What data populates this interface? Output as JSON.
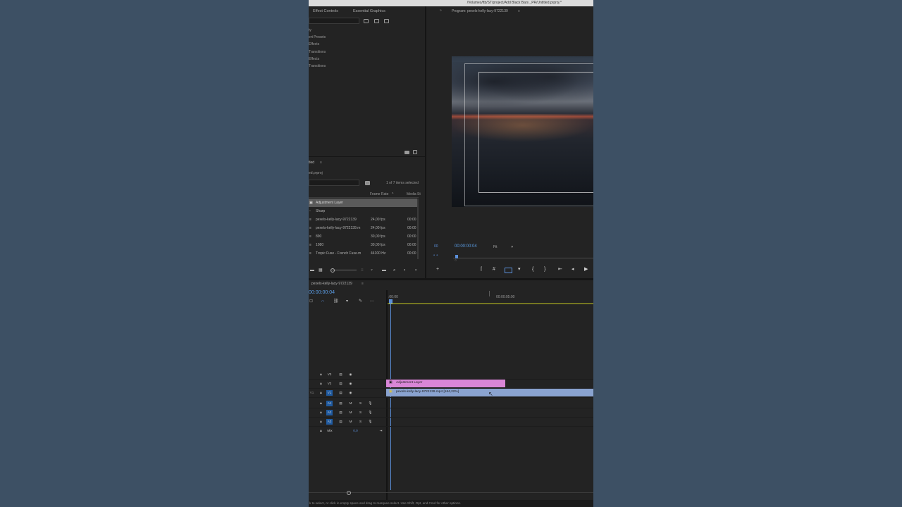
{
  "window": {
    "title_path": "/Volumes/ftb/ST/project/Add Black Bars _PR/Untitled.prproj *"
  },
  "effects_panel": {
    "tabs": [
      "Effect Controls",
      "Essential Graphics"
    ],
    "items": [
      "ty",
      "ert Presets",
      "Effects",
      "Transitions",
      "Effects",
      "Transitions"
    ]
  },
  "project_panel": {
    "title": "tled",
    "path": "ed.prproj",
    "selection_status": "1 of 7 items selected",
    "columns": [
      "Frame Rate",
      "Media St"
    ],
    "rows": [
      {
        "name": "Adjustment Layer",
        "fps": "",
        "start": ""
      },
      {
        "name": "Sharp",
        "fps": "",
        "start": ""
      },
      {
        "name": "pexels-kelly-lacy-9722139",
        "fps": "24,00 fps",
        "start": "00:00"
      },
      {
        "name": "pexels-kelly-lacy-9722139.m",
        "fps": "24,00 fps",
        "start": "00:00"
      },
      {
        "name": "890",
        "fps": "30,00 fps",
        "start": "00:00"
      },
      {
        "name": "1080",
        "fps": "30,00 fps",
        "start": "00:00"
      },
      {
        "name": "Tropic Fuse - French Fuse.m",
        "fps": "44100 Hz",
        "start": "00:00"
      }
    ]
  },
  "program_monitor": {
    "title": "Program: pexels-kelly-lacy-9722139",
    "timecode": "00:00:00:04",
    "fit": "Fit",
    "left_code": "00"
  },
  "timeline": {
    "sequence_tab": "pexels-kelly-lacy-9722139",
    "timecode": "00:00:00:04",
    "ruler_labels": [
      ":00:00",
      "00:00:05:00"
    ],
    "video_tracks": [
      "V3",
      "V2",
      "V1"
    ],
    "audio_tracks": [
      "A1",
      "A2",
      "A3"
    ],
    "source_patch": "V1",
    "mix_label": "Mix",
    "mix_value": "0,0",
    "clips": {
      "adjustment": "Adjustment Layer",
      "video": "pexels-kelly-lacy-9722139.mp4 [164,22%]"
    },
    "mute_label": "M",
    "solo_label": "S"
  },
  "status_bar": {
    "text": "k to select, or click in empty space and drag to marquee select. Use Shift, Opt, and Cmd for other options."
  },
  "colors": {
    "adjustment_clip": "#d986d8",
    "video_clip": "#8aa3d0",
    "playhead": "#5b8fd9",
    "work_area": "#c4c820",
    "selected_track": "#1f5aa0"
  }
}
